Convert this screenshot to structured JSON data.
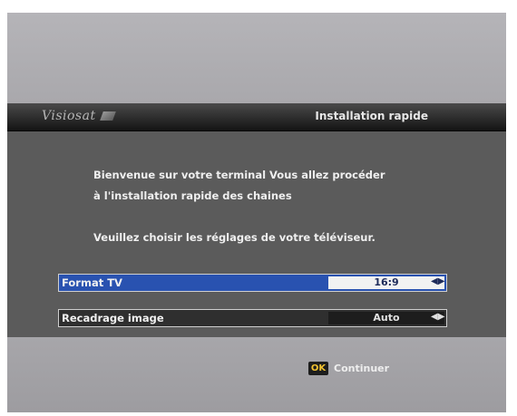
{
  "header": {
    "logo_text": "Visiosat",
    "title": "Installation rapide"
  },
  "message": {
    "line1": "Bienvenue sur votre terminal Vous allez procéder",
    "line2": "à l'installation rapide des chaines",
    "line3": "Veuillez choisir les réglages de votre téléviseur."
  },
  "settings": [
    {
      "label": "Format TV",
      "value": "16:9",
      "selected": true
    },
    {
      "label": "Recadrage image",
      "value": "Auto",
      "selected": false
    }
  ],
  "footer": {
    "ok_key": "OK",
    "ok_label": "Continuer"
  },
  "colors": {
    "selection": "#2952b0",
    "ok_key_text": "#f2c230"
  }
}
